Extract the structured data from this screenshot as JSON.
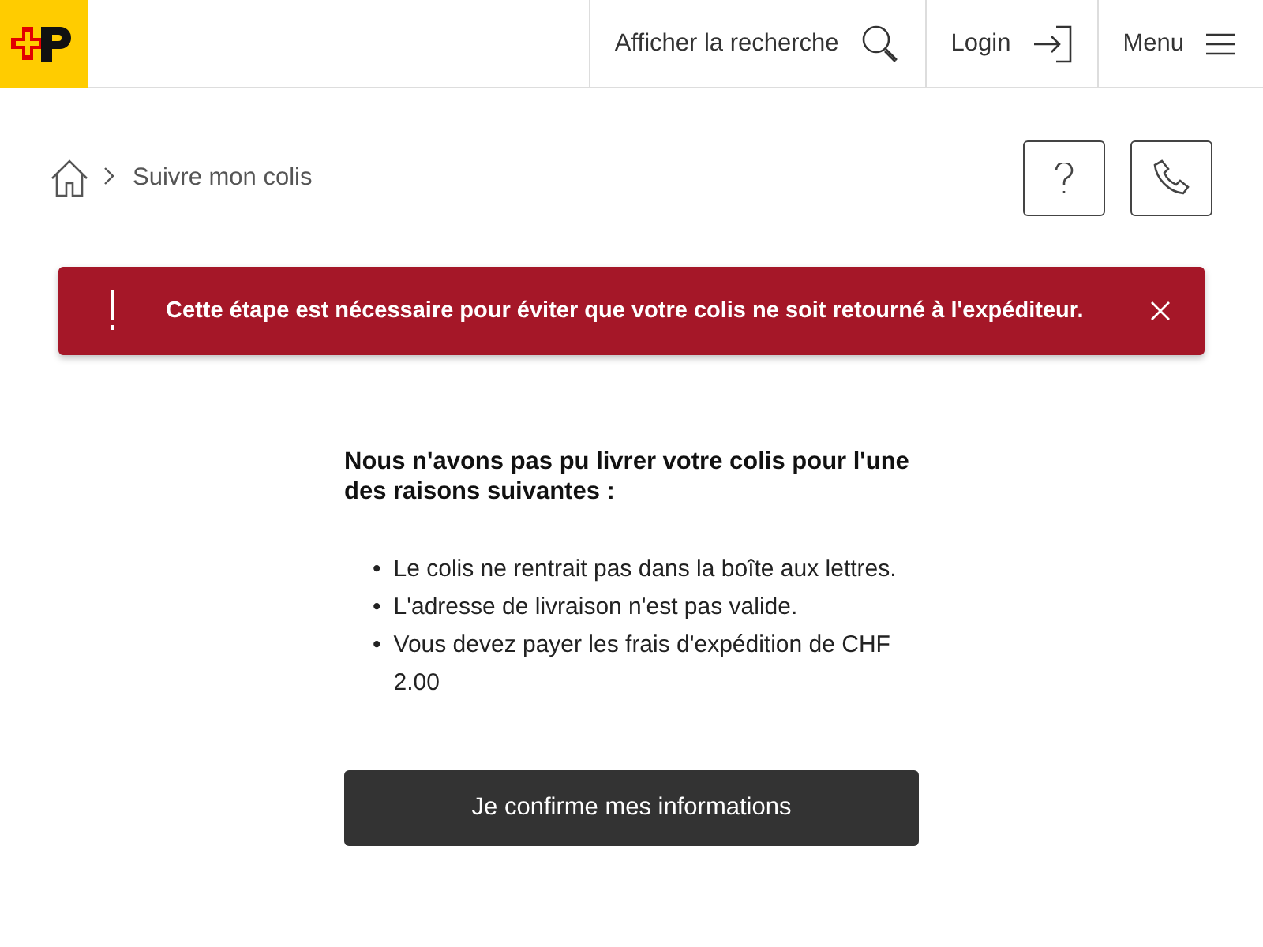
{
  "header": {
    "search_label": "Afficher la recherche",
    "login_label": "Login",
    "menu_label": "Menu"
  },
  "breadcrumb": {
    "items": [
      "Suivre mon colis"
    ]
  },
  "alert": {
    "message": "Cette étape est nécessaire pour éviter que votre colis ne soit retourné à l'expéditeur."
  },
  "content": {
    "heading": "Nous n'avons pas pu livrer votre colis pour l'une des raisons suivantes :",
    "bullet": "•",
    "reasons": [
      "Le colis ne rentrait pas dans la boîte aux lettres.",
      "L'adresse de livraison n'est pas valide.",
      "Vous devez payer les frais d'expédition de CHF 2.00"
    ],
    "button": "Je confirme mes informations"
  }
}
